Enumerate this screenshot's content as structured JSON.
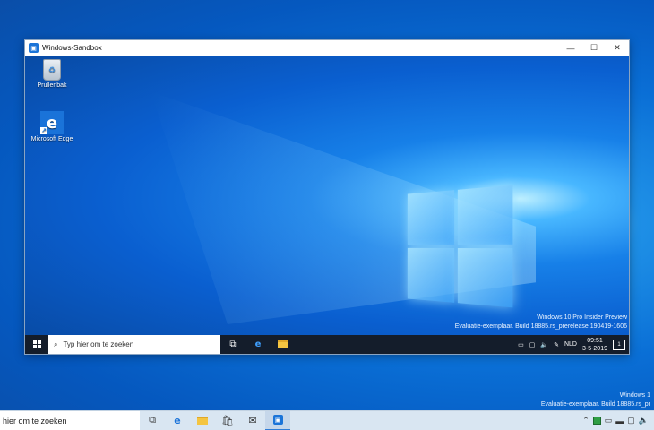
{
  "window": {
    "title": "Windows-Sandbox",
    "minimize_glyph": "—",
    "maximize_glyph": "☐",
    "close_glyph": "✕"
  },
  "guest": {
    "desktop_icons": [
      {
        "label": "Prullenbak",
        "icon": "recycle-bin-icon"
      },
      {
        "label": "Microsoft Edge",
        "icon": "edge-icon"
      }
    ],
    "watermark": {
      "line1": "Windows 10 Pro Insider Preview",
      "line2": "Evaluatie-exemplaar. Build 18885.rs_prerelease.190419-1606"
    },
    "taskbar": {
      "search_placeholder": "Typ hier om te zoeken",
      "language": "NLD",
      "time": "09:51",
      "date": "3-5-2019",
      "notification_count": "1"
    }
  },
  "host": {
    "watermark": {
      "line1": "Windows 1",
      "line2": "Evaluatie-exemplaar. Build 18885.rs_pr"
    },
    "taskbar": {
      "search_text": "hier om te zoeken"
    }
  },
  "colors": {
    "guest_taskbar": "#141d2b",
    "host_taskbar": "#d9e6f2",
    "accent": "#1a73d9"
  }
}
